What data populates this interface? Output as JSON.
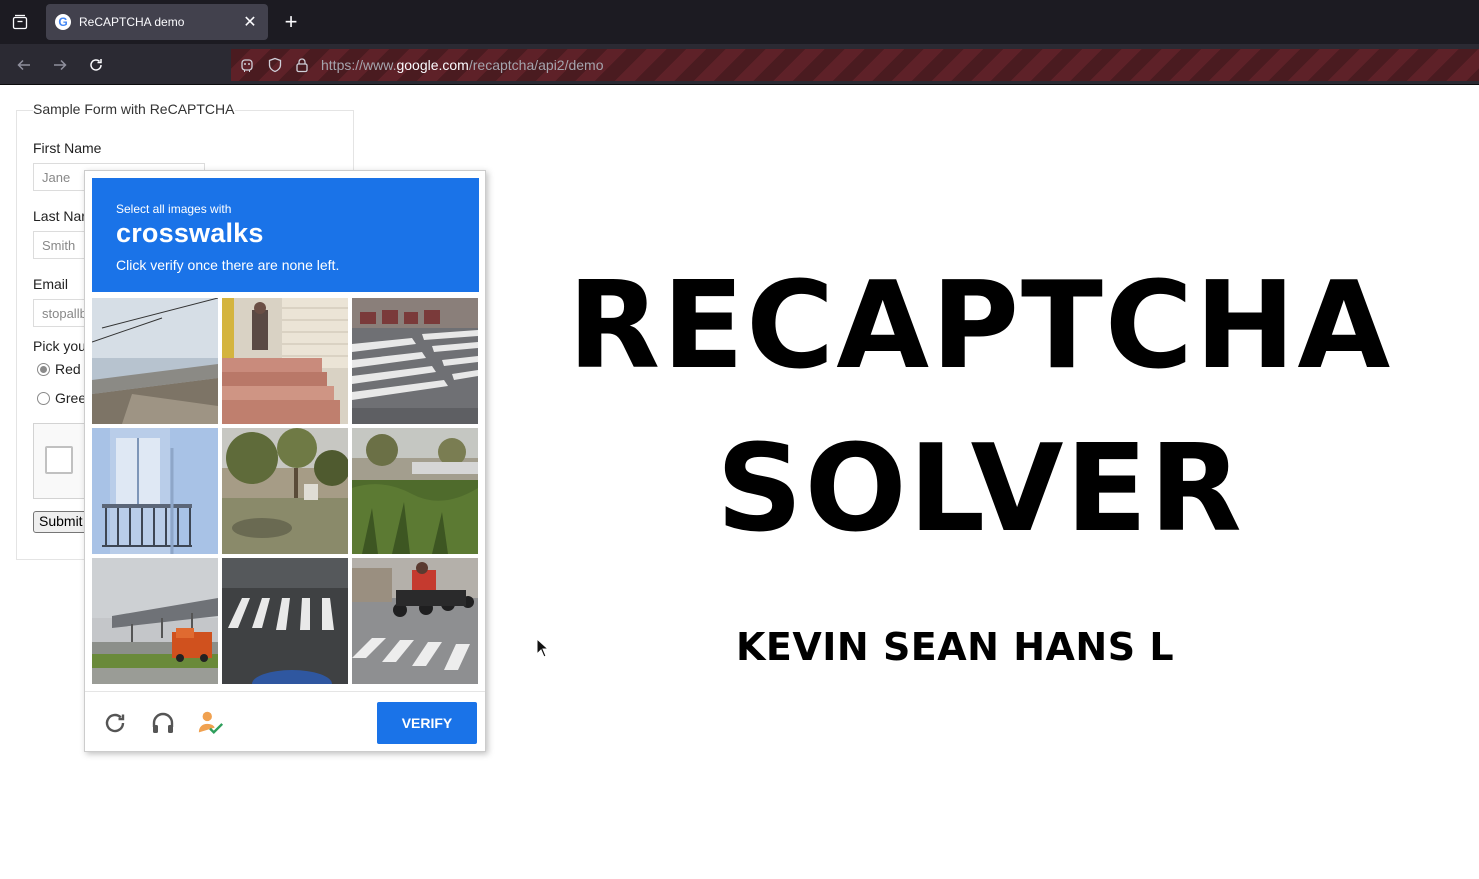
{
  "browser": {
    "tab_title": "ReCAPTCHA demo",
    "url_prefix": "https://www.",
    "url_host": "google.com",
    "url_path": "/recaptcha/api2/demo"
  },
  "form": {
    "legend": "Sample Form with ReCAPTCHA",
    "first_name_label": "First Name",
    "first_name_value": "Jane",
    "last_name_label": "Last Nar",
    "last_name_value": "Smith",
    "email_label": "Email",
    "email_value": "stopallb",
    "pick_label": "Pick you",
    "radio_red": "Red",
    "radio_green": "Gree",
    "submit_label": "Submit"
  },
  "challenge": {
    "instruction_small": "Select all images with",
    "target": "crosswalks",
    "instruction_note": "Click verify once there are none left.",
    "verify_label": "VERIFY",
    "tiles": [
      {
        "name": "tile-overpass"
      },
      {
        "name": "tile-steps"
      },
      {
        "name": "tile-crosswalk-1"
      },
      {
        "name": "tile-balcony"
      },
      {
        "name": "tile-park"
      },
      {
        "name": "tile-field"
      },
      {
        "name": "tile-highway-truck"
      },
      {
        "name": "tile-crosswalk-2"
      },
      {
        "name": "tile-crosswalk-motorbikes"
      }
    ],
    "footer_icons": [
      "reload-icon",
      "headphones-icon",
      "person-check-icon"
    ]
  },
  "headline": {
    "line1": "RECAPTCHA",
    "line2": "SOLVER",
    "author": "KEVIN SEAN HANS L"
  },
  "colors": {
    "challenge_blue": "#1a73e8",
    "tab_bg": "#42414d",
    "toolbar_bg": "#2b2a33"
  }
}
